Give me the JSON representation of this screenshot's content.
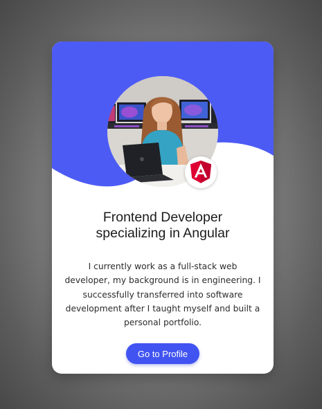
{
  "profile_card": {
    "avatar": "developer-photo",
    "badge": "angular-logo-icon",
    "title_line1": "Frontend Developer",
    "title_line2": "specializing in Angular",
    "bio": "I currently work as a full-stack web developer, my background is in engineering. I successfully transferred into software development after I taught myself and built a personal portfolio.",
    "button_label": "Go to Profile"
  },
  "colors": {
    "accent": "#4154f1",
    "wave": "#4d5bf5",
    "angular_red": "#dd0031",
    "angular_dark": "#c3002f",
    "card_bg": "#ffffff"
  }
}
